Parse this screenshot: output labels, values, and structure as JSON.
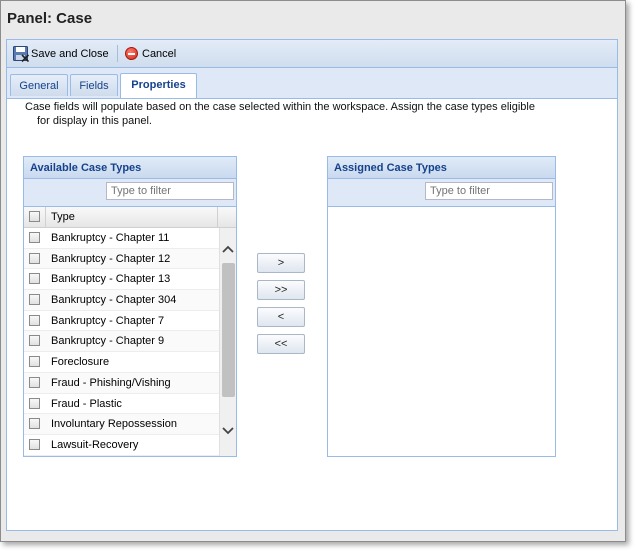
{
  "panel": {
    "title": "Panel: Case"
  },
  "toolbar": {
    "save_close_label": "Save and Close",
    "cancel_label": "Cancel"
  },
  "tabs": [
    {
      "label": "General",
      "active": false
    },
    {
      "label": "Fields",
      "active": false
    },
    {
      "label": "Properties",
      "active": true
    }
  ],
  "description": {
    "line1": "Case fields will populate based on the case selected within the workspace. Assign the case types eligible",
    "line2": "for display in this panel."
  },
  "available": {
    "title": "Available Case Types",
    "filter_placeholder": "Type to filter",
    "column_header": "Type",
    "rows": [
      "Bankruptcy - Chapter 11",
      "Bankruptcy - Chapter 12",
      "Bankruptcy - Chapter 13",
      "Bankruptcy - Chapter 304",
      "Bankruptcy - Chapter 7",
      "Bankruptcy - Chapter 9",
      "Foreclosure",
      "Fraud - Phishing/Vishing",
      "Fraud - Plastic",
      "Involuntary Repossession",
      "Lawsuit-Recovery"
    ]
  },
  "assigned": {
    "title": "Assigned Case Types",
    "filter_placeholder": "Type to filter"
  },
  "transfer_buttons": {
    "move_one_label": ">",
    "move_all_label": ">>",
    "remove_one_label": "<",
    "remove_all_label": "<<"
  },
  "colors": {
    "header_text": "#15428b",
    "border": "#99bbe8",
    "cancel_icon": "#d2271a"
  },
  "icons": [
    "save-close-icon",
    "cancel-icon",
    "scroll-up-icon",
    "scroll-down-icon"
  ]
}
